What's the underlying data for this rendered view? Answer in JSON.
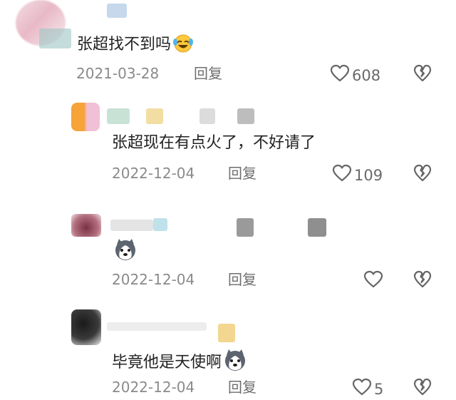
{
  "comments": [
    {
      "text": "张超找不到吗",
      "emoji": "laughing-tears-emoji",
      "date": "2021-03-28",
      "reply_label": "回复",
      "likes": "608"
    },
    {
      "text": "张超现在有点火了，不好请了",
      "date": "2022-12-04",
      "reply_label": "回复",
      "likes": "109"
    },
    {
      "text": "",
      "emoji": "husky-dog-emoji",
      "date": "2022-12-04",
      "reply_label": "回复",
      "likes": ""
    },
    {
      "text": "毕竟他是天使啊",
      "emoji": "husky-dog-emoji",
      "date": "2022-12-04",
      "reply_label": "回复",
      "likes": "5"
    }
  ],
  "icons": {
    "like": "heart-outline-icon",
    "dislike": "broken-heart-icon"
  },
  "colors": {
    "text": "#222222",
    "meta": "#8a8a8a",
    "icon": "#6a6a6a"
  }
}
